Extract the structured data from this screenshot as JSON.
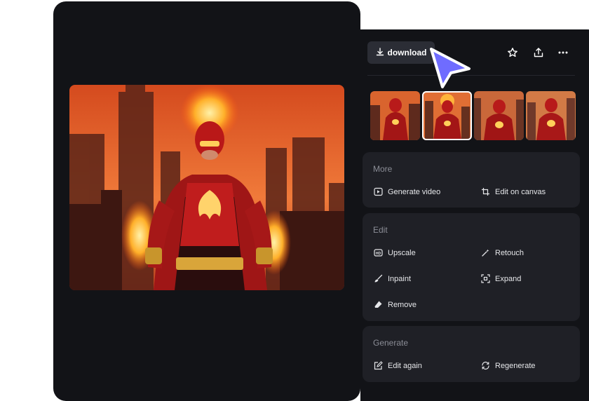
{
  "header": {
    "download_label": "download",
    "icons": [
      "star-icon",
      "share-icon",
      "more-icon"
    ]
  },
  "thumbnails": {
    "count": 4,
    "selected_index": 1
  },
  "sections": {
    "more": {
      "title": "More",
      "generate_video": "Generate video",
      "edit_on_canvas": "Edit on canvas"
    },
    "edit": {
      "title": "Edit",
      "upscale": "Upscale",
      "retouch": "Retouch",
      "inpaint": "Inpaint",
      "expand": "Expand",
      "remove": "Remove"
    },
    "generate": {
      "title": "Generate",
      "edit_again": "Edit again",
      "regenerate": "Regenerate"
    }
  },
  "colors": {
    "background": "#121317",
    "section": "#1f2026",
    "button": "#2b2d35",
    "cursor": "#6f6cff"
  }
}
